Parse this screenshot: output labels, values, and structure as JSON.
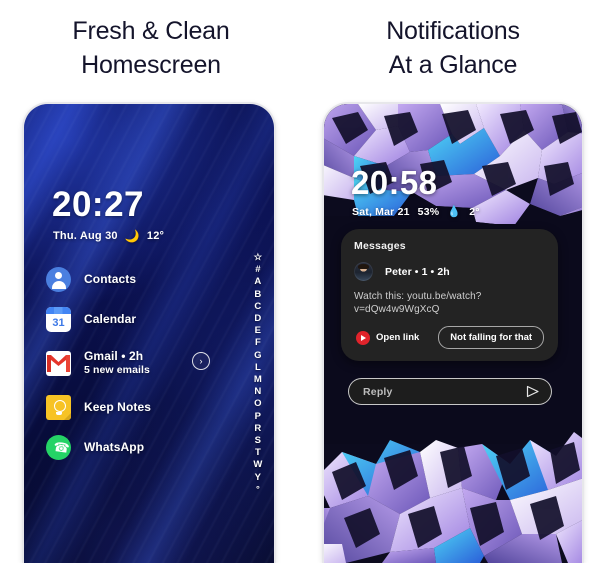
{
  "panels": [
    {
      "heading_line1": "Fresh & Clean",
      "heading_line2": "Homescreen"
    },
    {
      "heading_line1": "Notifications",
      "heading_line2": "At a Glance"
    }
  ],
  "left_phone": {
    "clock": "20:27",
    "date": "Thu. Aug 30",
    "weather_icon": "🌙",
    "temperature": "12°",
    "apps": [
      {
        "icon": "contacts-icon",
        "label": "Contacts",
        "sub": ""
      },
      {
        "icon": "calendar-icon",
        "label": "Calendar",
        "sub": "",
        "day": "31"
      },
      {
        "icon": "gmail-icon",
        "label": "Gmail • 2h",
        "sub": "5 new emails",
        "expand": "›"
      },
      {
        "icon": "keep-notes-icon",
        "label": "Keep Notes",
        "sub": ""
      },
      {
        "icon": "whatsapp-icon",
        "label": "WhatsApp",
        "sub": ""
      }
    ],
    "alphabet_index": [
      "☆",
      "#",
      "A",
      "B",
      "C",
      "D",
      "E",
      "F",
      "G",
      "L",
      "M",
      "N",
      "O",
      "P",
      "R",
      "S",
      "T",
      "W",
      "Y",
      "°"
    ]
  },
  "right_phone": {
    "clock": "20:58",
    "date": "Sat, Mar 21",
    "battery": "53%",
    "weather_icon": "💧",
    "temperature": "2°",
    "notification": {
      "app_name": "Messages",
      "sender": "Peter • 1 • 2h",
      "message": "Watch this: youtu.be/watch?v=dQw4w9WgXcQ",
      "actions": [
        {
          "label": "Open link",
          "icon": "youtube-icon"
        },
        {
          "label": "Not falling for that",
          "icon": ""
        }
      ]
    },
    "reply": {
      "placeholder": "Reply",
      "send_icon": "send-icon"
    }
  },
  "colors": {
    "heading": "#14142b",
    "page_bg": "#ffffff",
    "notif_bg": "#232323",
    "youtube_red": "#e0232b",
    "whatsapp_green": "#25d366",
    "keep_yellow": "#f7c325",
    "calendar_blue": "#4285f4",
    "contacts_blue": "#4a7fe0"
  }
}
